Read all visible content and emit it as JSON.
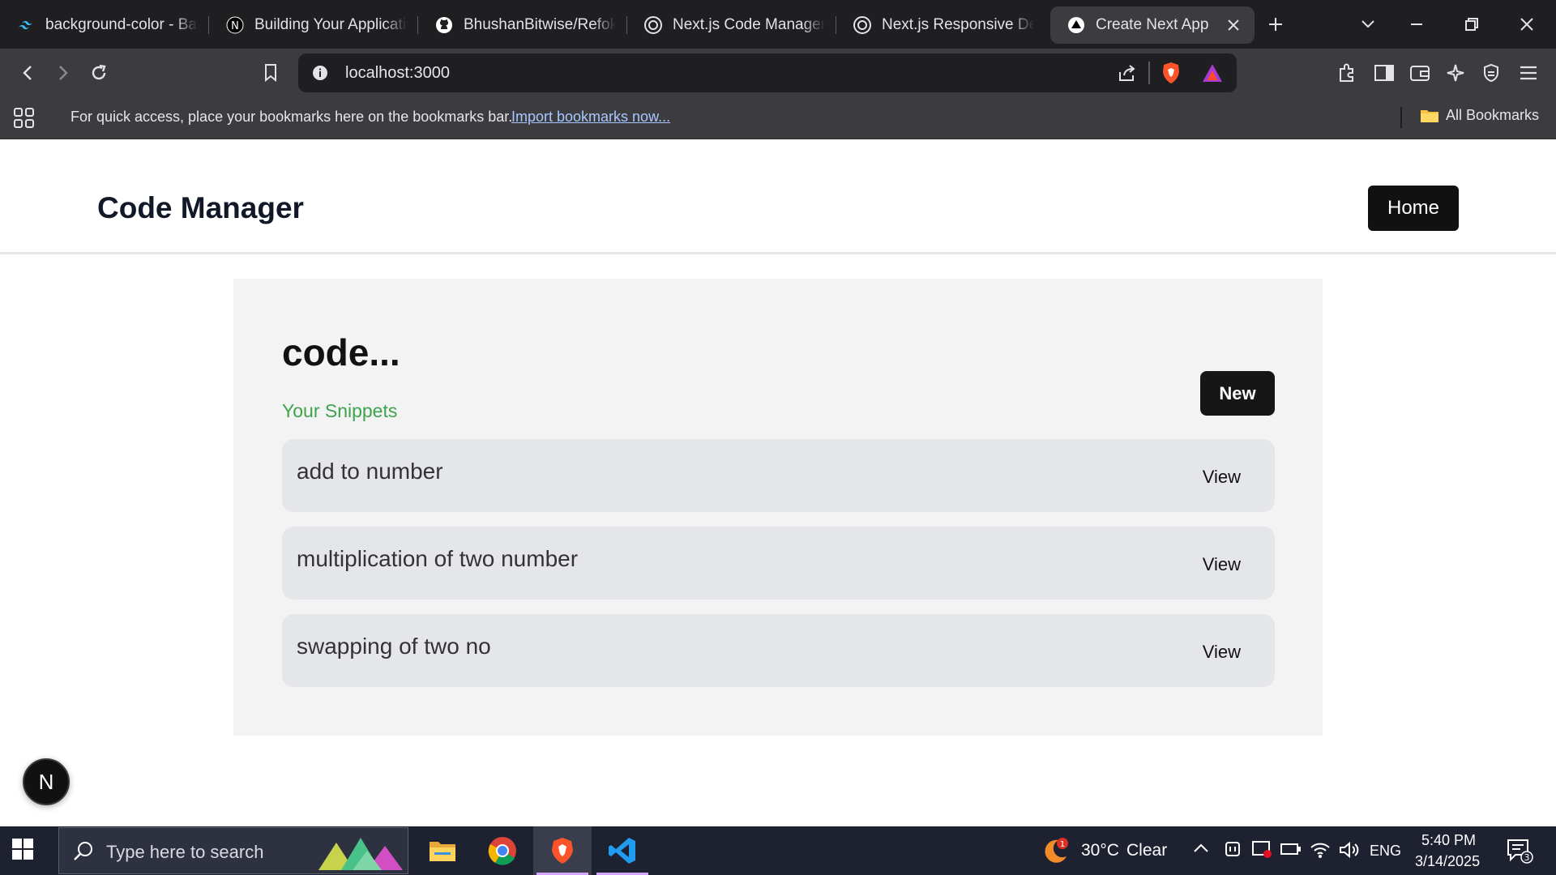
{
  "browser": {
    "tabs": [
      {
        "title": "background-color - Bac",
        "icon": "tailwind-icon"
      },
      {
        "title": "Building Your Applicatio",
        "icon": "nextjs-n-icon"
      },
      {
        "title": "BhushanBitwise/Refoku",
        "icon": "github-icon"
      },
      {
        "title": "Next.js Code Manager I",
        "icon": "openai-icon"
      },
      {
        "title": "Next.js Responsive Desi",
        "icon": "openai-icon"
      },
      {
        "title": "Create Next App",
        "icon": "vercel-triangle-icon",
        "active": true
      }
    ],
    "url": "localhost:3000",
    "bookmarks_bar": {
      "message": "For quick access, place your bookmarks here on the bookmarks bar.",
      "link": "Import bookmarks now...",
      "all_bookmarks": "All Bookmarks"
    }
  },
  "page": {
    "header": {
      "title": "Code Manager",
      "home_button": "Home"
    },
    "panel": {
      "title": "code...",
      "subtitle": "Your Snippets",
      "new_button": "New",
      "snippets": [
        {
          "name": "add to number",
          "action": "View"
        },
        {
          "name": "multiplication of two number",
          "action": "View"
        },
        {
          "name": "swapping of two no",
          "action": "View"
        }
      ]
    },
    "dev_badge": "N"
  },
  "taskbar": {
    "search_placeholder": "Type here to search",
    "weather": {
      "temp": "30°C",
      "condition": "Clear",
      "alerts": "1"
    },
    "language": "ENG",
    "time": "5:40 PM",
    "date": "3/14/2025",
    "notifications": "3"
  },
  "colors": {
    "accent_green": "#3fa34d",
    "button_dark": "#111111",
    "panel_bg": "#f3f3f3",
    "snippet_bg": "#e5e6ea"
  }
}
